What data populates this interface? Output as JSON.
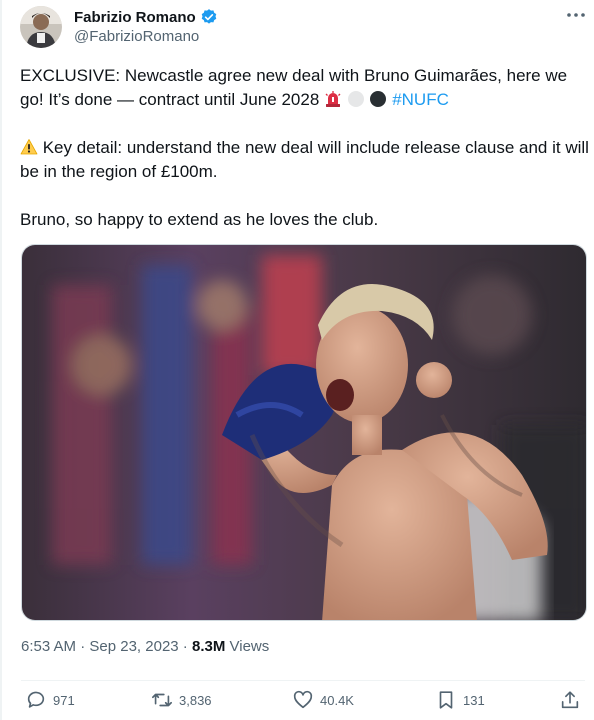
{
  "author": {
    "display_name": "Fabrizio Romano",
    "handle": "@FabrizioRomano",
    "verified_icon": "verified-badge-icon",
    "verified_color": "#1d9bf0"
  },
  "tweet": {
    "para1_text": "EXCLUSIVE: Newcastle agree new deal with Bruno Guimarães, here we go! It’s done — contract until June 2028 ",
    "para1_hashtag": "#NUFC",
    "para1_emojis": [
      "rotating-light-icon",
      "white-circle-icon",
      "black-circle-icon"
    ],
    "para2_emoji": "warning-icon",
    "para2_text": " Key detail: understand the new deal will include release clause and it will be in the region of £100m.",
    "para3_text": "Bruno, so happy to extend as he loves the club."
  },
  "meta": {
    "time": "6:53 AM",
    "separator": " · ",
    "date": "Sep 23, 2023",
    "views_count": "8.3M",
    "views_label": " Views"
  },
  "actions": {
    "replies": "971",
    "reposts": "3,836",
    "likes": "40.4K",
    "bookmarks": "131"
  },
  "colors": {
    "text": "#0f1419",
    "secondary": "#536471",
    "link": "#1d9bf0",
    "border": "#cfd9de"
  }
}
